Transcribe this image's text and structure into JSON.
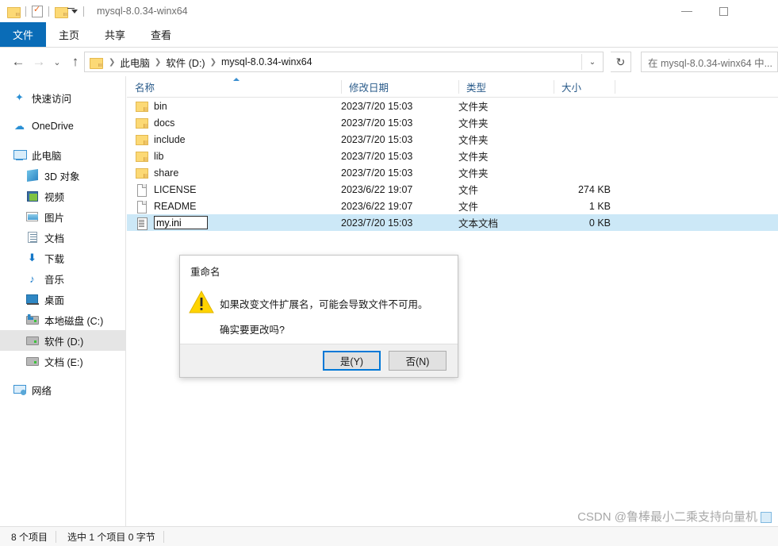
{
  "window": {
    "title": "mysql-8.0.34-winx64",
    "quick_access": [
      {
        "name": "folder-icon",
        "label": ""
      },
      {
        "name": "properties-icon",
        "label": ""
      },
      {
        "name": "new-folder-icon",
        "label": ""
      },
      {
        "name": "customize-qat-caret-icon",
        "label": ""
      }
    ],
    "controls": {
      "minimize": "—",
      "maximize": "□",
      "close": "✕"
    }
  },
  "ribbon": {
    "tabs": [
      {
        "label": "文件",
        "active": true
      },
      {
        "label": "主页",
        "active": false
      },
      {
        "label": "共享",
        "active": false
      },
      {
        "label": "查看",
        "active": false
      }
    ]
  },
  "navbar": {
    "back": "←",
    "forward": "→",
    "recent": "⌄",
    "up": "↑",
    "breadcrumb": [
      "此电脑",
      "软件 (D:)",
      "mysql-8.0.34-winx64"
    ],
    "breadcrumb_separator": "❯",
    "address_dropdown": "⌄",
    "refresh": "↻",
    "search_placeholder": "在 mysql-8.0.34-winx64 中..."
  },
  "sidebar": {
    "items": [
      {
        "label": "快速访问",
        "icon": "pin-star-icon",
        "level": 0
      },
      {
        "label": "OneDrive",
        "icon": "cloud-icon",
        "level": 0
      },
      {
        "label": "此电脑",
        "icon": "this-pc-icon",
        "level": 0
      },
      {
        "label": "3D 对象",
        "icon": "3d-objects-icon",
        "level": 1
      },
      {
        "label": "视频",
        "icon": "videos-icon",
        "level": 1
      },
      {
        "label": "图片",
        "icon": "pictures-icon",
        "level": 1
      },
      {
        "label": "文档",
        "icon": "documents-icon",
        "level": 1
      },
      {
        "label": "下载",
        "icon": "downloads-icon",
        "level": 1
      },
      {
        "label": "音乐",
        "icon": "music-icon",
        "level": 1
      },
      {
        "label": "桌面",
        "icon": "desktop-icon",
        "level": 1
      },
      {
        "label": "本地磁盘 (C:)",
        "icon": "windows-drive-icon",
        "level": 1
      },
      {
        "label": "软件 (D:)",
        "icon": "drive-icon",
        "level": 1,
        "selected": true
      },
      {
        "label": "文档 (E:)",
        "icon": "drive-icon",
        "level": 1
      },
      {
        "label": "网络",
        "icon": "network-icon",
        "level": 0
      }
    ]
  },
  "filelist": {
    "columns": [
      {
        "label": "名称",
        "sorted": "asc"
      },
      {
        "label": "修改日期"
      },
      {
        "label": "类型"
      },
      {
        "label": "大小"
      }
    ],
    "rows": [
      {
        "name": "bin",
        "icon": "folder-icon",
        "date": "2023/7/20 15:03",
        "type": "文件夹",
        "size": ""
      },
      {
        "name": "docs",
        "icon": "folder-icon",
        "date": "2023/7/20 15:03",
        "type": "文件夹",
        "size": ""
      },
      {
        "name": "include",
        "icon": "folder-icon",
        "date": "2023/7/20 15:03",
        "type": "文件夹",
        "size": ""
      },
      {
        "name": "lib",
        "icon": "folder-icon",
        "date": "2023/7/20 15:03",
        "type": "文件夹",
        "size": ""
      },
      {
        "name": "share",
        "icon": "folder-icon",
        "date": "2023/7/20 15:03",
        "type": "文件夹",
        "size": ""
      },
      {
        "name": "LICENSE",
        "icon": "generic-file-icon",
        "date": "2023/6/22 19:07",
        "type": "文件",
        "size": "274 KB"
      },
      {
        "name": "README",
        "icon": "generic-file-icon",
        "date": "2023/6/22 19:07",
        "type": "文件",
        "size": "1 KB"
      },
      {
        "name": "my.ini",
        "icon": "text-document-icon",
        "date": "2023/7/20 15:03",
        "type": "文本文档",
        "size": "0 KB",
        "selected": true,
        "renaming": true
      }
    ],
    "rename_value": "my.ini"
  },
  "dialog": {
    "title": "重命名",
    "icon": "warning-triangle-icon",
    "message_line1": "如果改变文件扩展名，可能会导致文件不可用。",
    "message_line2": "确实要更改吗?",
    "yes_label": "是(Y)",
    "no_label": "否(N)",
    "default_button": "yes"
  },
  "statusbar": {
    "item_count": "8 个项目",
    "selection_info": "选中 1 个项目  0 字节"
  },
  "watermark": {
    "text": "CSDN @鲁棒最小二乘支持向量机"
  },
  "colors": {
    "accent_blue": "#0a6cb7",
    "selection_blue": "#cce8f7",
    "focus_blue": "#0078d7",
    "folder_yellow": "#fcd975",
    "header_text": "#2a5b8a",
    "warning_yellow": "#ffd400"
  }
}
